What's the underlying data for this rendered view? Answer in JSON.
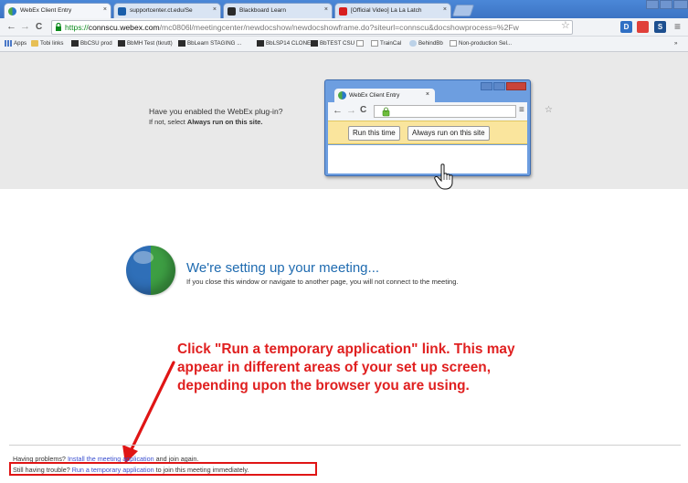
{
  "tabs": [
    {
      "label": "WebEx Client Entry",
      "close": "×",
      "favicon_color": "#2a78c9"
    },
    {
      "label": "supportcenter.ct.edu/Se",
      "close": "×",
      "favicon_color": "#1a5eaa"
    },
    {
      "label": "Blackboard Learn",
      "close": "×",
      "favicon_color": "#2b2b2b"
    },
    {
      "label": "[Official Video] La La Latch",
      "close": "×",
      "favicon_color": "#d81e1e"
    }
  ],
  "toolbar": {
    "back_icon": "←",
    "forward_icon": "→",
    "reload_icon": "C",
    "url_scheme": "https://",
    "url_host": "connscu.webex.com",
    "url_path": "/mc0806l/meetingcenter/newdocshow/newdocshowframe.do?siteurl=connscu&docshowprocess=%2Fw",
    "star_icon": "☆",
    "menu_icon": "≡",
    "extensions": [
      {
        "label": "D",
        "color": "#2f6fc4"
      },
      {
        "label": "",
        "color": "#e0403a"
      },
      {
        "label": "S",
        "color": "#1d4f8f"
      }
    ]
  },
  "bookmarks": [
    {
      "label": "Apps",
      "icon": "apps-grid"
    },
    {
      "label": "Tobi links",
      "icon": "folder"
    },
    {
      "label": "BbCSU prod",
      "icon": "bb"
    },
    {
      "label": "BbMH Test (tkrutt)",
      "icon": "bb"
    },
    {
      "label": "BbLearn STAGING ...",
      "icon": "bb"
    },
    {
      "label": "BbLSP14 CLONE",
      "icon": "bb"
    },
    {
      "label": "BbTEST CSU",
      "icon": "bb"
    },
    {
      "label": "",
      "icon": "page"
    },
    {
      "label": "TrainCal",
      "icon": "page"
    },
    {
      "label": "BehindBb",
      "icon": "cloud"
    },
    {
      "label": "Non-production Sel...",
      "icon": "page"
    },
    {
      "label": "»",
      "icon": "none"
    }
  ],
  "plugin_hint": {
    "question": "Have you enabled the WebEx plug-in?",
    "instruction_prefix": "If not, select ",
    "instruction_bold": "Always run on this site."
  },
  "mini_window": {
    "tab_label": "WebEx Client Entry",
    "close": "×",
    "back_icon": "←",
    "forward_icon": "→",
    "reload_icon": "C",
    "star_icon": "☆",
    "menu_icon": "≡",
    "run_this_time": "Run this time",
    "always_run": "Always run on this site"
  },
  "main": {
    "title": "We're setting up your meeting...",
    "subtitle": "If you close this window or navigate to another page, you will not connect to the meeting."
  },
  "callout": {
    "lines": [
      "Click \"Run a temporary application\" link. This may",
      "appear in different areas of your set up screen,",
      "depending upon the browser you are using."
    ],
    "color": "#e02020"
  },
  "footer": {
    "problems_prefix": "Having problems? ",
    "install_link": "Install the meeting application",
    "problems_suffix": " and join again.",
    "trouble_prefix": "Still having trouble? ",
    "temp_link": "Run a temporary application",
    "trouble_suffix": " to join this meeting immediately."
  },
  "colors": {
    "accent_blue": "#1f6bb0",
    "link": "#3a4fd0",
    "highlight_red": "#e01515",
    "infobar_yellow": "#fae59d"
  }
}
